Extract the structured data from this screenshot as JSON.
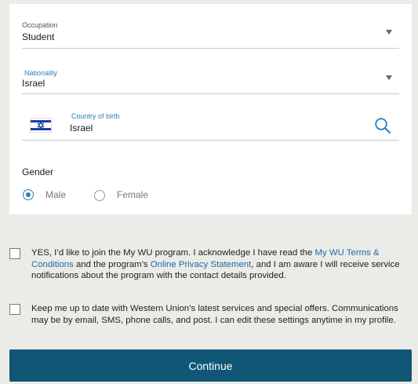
{
  "form": {
    "occupation": {
      "label": "Occupation",
      "value": "Student",
      "icon": "chevron-down-icon"
    },
    "nationality": {
      "label": "Nationality",
      "value": "Israel",
      "icon": "chevron-down-icon"
    },
    "country_of_birth": {
      "label": "Country of birth",
      "value": "Israel",
      "flag_icon": "israel-flag-icon",
      "search_icon": "search-icon"
    },
    "gender": {
      "label": "Gender",
      "options": [
        {
          "label": "Male",
          "selected": true
        },
        {
          "label": "Female",
          "selected": false
        }
      ]
    }
  },
  "consents": {
    "mywu": {
      "checked": false,
      "text_before": "YES, I’d like to join the My WU program. I acknowledge I have read the ",
      "link1": "My WU Terms & Conditions",
      "text_middle": " and the program’s ",
      "link2": "Online Privacy Statement",
      "text_after": ", and I am aware I will receive service notifications about the program with the contact details provided."
    },
    "marketing": {
      "checked": false,
      "text": "Keep me up to date with Western Union’s latest services and special offers. Communications may be by email, SMS, phone calls, and post. I can edit these settings anytime in my profile."
    }
  },
  "continue_label": "Continue",
  "colors": {
    "page_bg": "#ebebe8",
    "accent_blue": "#2f7fb6",
    "link": "#1f6aa8",
    "button_bg": "#0f5775",
    "flag_blue": "#1c3fa8"
  }
}
